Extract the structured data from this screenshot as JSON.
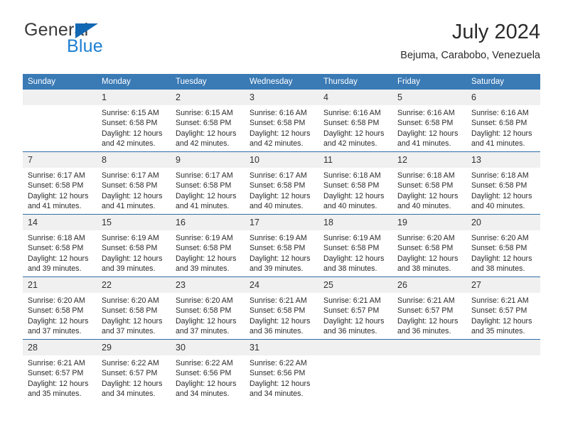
{
  "brand": {
    "line1": "General",
    "line2": "Blue",
    "triangle_icon": "brand-triangle-icon",
    "colors": {
      "line1": "#3a3a3a",
      "line2": "#1c7fd1",
      "triangle": "#1268b3"
    }
  },
  "header": {
    "title": "July 2024",
    "subtitle": "Bejuma, Carabobo, Venezuela"
  },
  "colors": {
    "header_bar": "#3a7ab5",
    "row_divider": "#2f6ea8",
    "daynum_background": "#f0f0f0",
    "text": "#2a2a2a"
  },
  "calendar": {
    "weekday_headers": [
      "Sunday",
      "Monday",
      "Tuesday",
      "Wednesday",
      "Thursday",
      "Friday",
      "Saturday"
    ],
    "weeks": [
      [
        {
          "day": "",
          "lines": []
        },
        {
          "day": "1",
          "lines": [
            "Sunrise: 6:15 AM",
            "Sunset: 6:58 PM",
            "Daylight: 12 hours",
            "and 42 minutes."
          ]
        },
        {
          "day": "2",
          "lines": [
            "Sunrise: 6:15 AM",
            "Sunset: 6:58 PM",
            "Daylight: 12 hours",
            "and 42 minutes."
          ]
        },
        {
          "day": "3",
          "lines": [
            "Sunrise: 6:16 AM",
            "Sunset: 6:58 PM",
            "Daylight: 12 hours",
            "and 42 minutes."
          ]
        },
        {
          "day": "4",
          "lines": [
            "Sunrise: 6:16 AM",
            "Sunset: 6:58 PM",
            "Daylight: 12 hours",
            "and 42 minutes."
          ]
        },
        {
          "day": "5",
          "lines": [
            "Sunrise: 6:16 AM",
            "Sunset: 6:58 PM",
            "Daylight: 12 hours",
            "and 41 minutes."
          ]
        },
        {
          "day": "6",
          "lines": [
            "Sunrise: 6:16 AM",
            "Sunset: 6:58 PM",
            "Daylight: 12 hours",
            "and 41 minutes."
          ]
        }
      ],
      [
        {
          "day": "7",
          "lines": [
            "Sunrise: 6:17 AM",
            "Sunset: 6:58 PM",
            "Daylight: 12 hours",
            "and 41 minutes."
          ]
        },
        {
          "day": "8",
          "lines": [
            "Sunrise: 6:17 AM",
            "Sunset: 6:58 PM",
            "Daylight: 12 hours",
            "and 41 minutes."
          ]
        },
        {
          "day": "9",
          "lines": [
            "Sunrise: 6:17 AM",
            "Sunset: 6:58 PM",
            "Daylight: 12 hours",
            "and 41 minutes."
          ]
        },
        {
          "day": "10",
          "lines": [
            "Sunrise: 6:17 AM",
            "Sunset: 6:58 PM",
            "Daylight: 12 hours",
            "and 40 minutes."
          ]
        },
        {
          "day": "11",
          "lines": [
            "Sunrise: 6:18 AM",
            "Sunset: 6:58 PM",
            "Daylight: 12 hours",
            "and 40 minutes."
          ]
        },
        {
          "day": "12",
          "lines": [
            "Sunrise: 6:18 AM",
            "Sunset: 6:58 PM",
            "Daylight: 12 hours",
            "and 40 minutes."
          ]
        },
        {
          "day": "13",
          "lines": [
            "Sunrise: 6:18 AM",
            "Sunset: 6:58 PM",
            "Daylight: 12 hours",
            "and 40 minutes."
          ]
        }
      ],
      [
        {
          "day": "14",
          "lines": [
            "Sunrise: 6:18 AM",
            "Sunset: 6:58 PM",
            "Daylight: 12 hours",
            "and 39 minutes."
          ]
        },
        {
          "day": "15",
          "lines": [
            "Sunrise: 6:19 AM",
            "Sunset: 6:58 PM",
            "Daylight: 12 hours",
            "and 39 minutes."
          ]
        },
        {
          "day": "16",
          "lines": [
            "Sunrise: 6:19 AM",
            "Sunset: 6:58 PM",
            "Daylight: 12 hours",
            "and 39 minutes."
          ]
        },
        {
          "day": "17",
          "lines": [
            "Sunrise: 6:19 AM",
            "Sunset: 6:58 PM",
            "Daylight: 12 hours",
            "and 39 minutes."
          ]
        },
        {
          "day": "18",
          "lines": [
            "Sunrise: 6:19 AM",
            "Sunset: 6:58 PM",
            "Daylight: 12 hours",
            "and 38 minutes."
          ]
        },
        {
          "day": "19",
          "lines": [
            "Sunrise: 6:20 AM",
            "Sunset: 6:58 PM",
            "Daylight: 12 hours",
            "and 38 minutes."
          ]
        },
        {
          "day": "20",
          "lines": [
            "Sunrise: 6:20 AM",
            "Sunset: 6:58 PM",
            "Daylight: 12 hours",
            "and 38 minutes."
          ]
        }
      ],
      [
        {
          "day": "21",
          "lines": [
            "Sunrise: 6:20 AM",
            "Sunset: 6:58 PM",
            "Daylight: 12 hours",
            "and 37 minutes."
          ]
        },
        {
          "day": "22",
          "lines": [
            "Sunrise: 6:20 AM",
            "Sunset: 6:58 PM",
            "Daylight: 12 hours",
            "and 37 minutes."
          ]
        },
        {
          "day": "23",
          "lines": [
            "Sunrise: 6:20 AM",
            "Sunset: 6:58 PM",
            "Daylight: 12 hours",
            "and 37 minutes."
          ]
        },
        {
          "day": "24",
          "lines": [
            "Sunrise: 6:21 AM",
            "Sunset: 6:58 PM",
            "Daylight: 12 hours",
            "and 36 minutes."
          ]
        },
        {
          "day": "25",
          "lines": [
            "Sunrise: 6:21 AM",
            "Sunset: 6:57 PM",
            "Daylight: 12 hours",
            "and 36 minutes."
          ]
        },
        {
          "day": "26",
          "lines": [
            "Sunrise: 6:21 AM",
            "Sunset: 6:57 PM",
            "Daylight: 12 hours",
            "and 36 minutes."
          ]
        },
        {
          "day": "27",
          "lines": [
            "Sunrise: 6:21 AM",
            "Sunset: 6:57 PM",
            "Daylight: 12 hours",
            "and 35 minutes."
          ]
        }
      ],
      [
        {
          "day": "28",
          "lines": [
            "Sunrise: 6:21 AM",
            "Sunset: 6:57 PM",
            "Daylight: 12 hours",
            "and 35 minutes."
          ]
        },
        {
          "day": "29",
          "lines": [
            "Sunrise: 6:22 AM",
            "Sunset: 6:57 PM",
            "Daylight: 12 hours",
            "and 34 minutes."
          ]
        },
        {
          "day": "30",
          "lines": [
            "Sunrise: 6:22 AM",
            "Sunset: 6:56 PM",
            "Daylight: 12 hours",
            "and 34 minutes."
          ]
        },
        {
          "day": "31",
          "lines": [
            "Sunrise: 6:22 AM",
            "Sunset: 6:56 PM",
            "Daylight: 12 hours",
            "and 34 minutes."
          ]
        },
        {
          "day": "",
          "lines": []
        },
        {
          "day": "",
          "lines": []
        },
        {
          "day": "",
          "lines": []
        }
      ]
    ]
  }
}
